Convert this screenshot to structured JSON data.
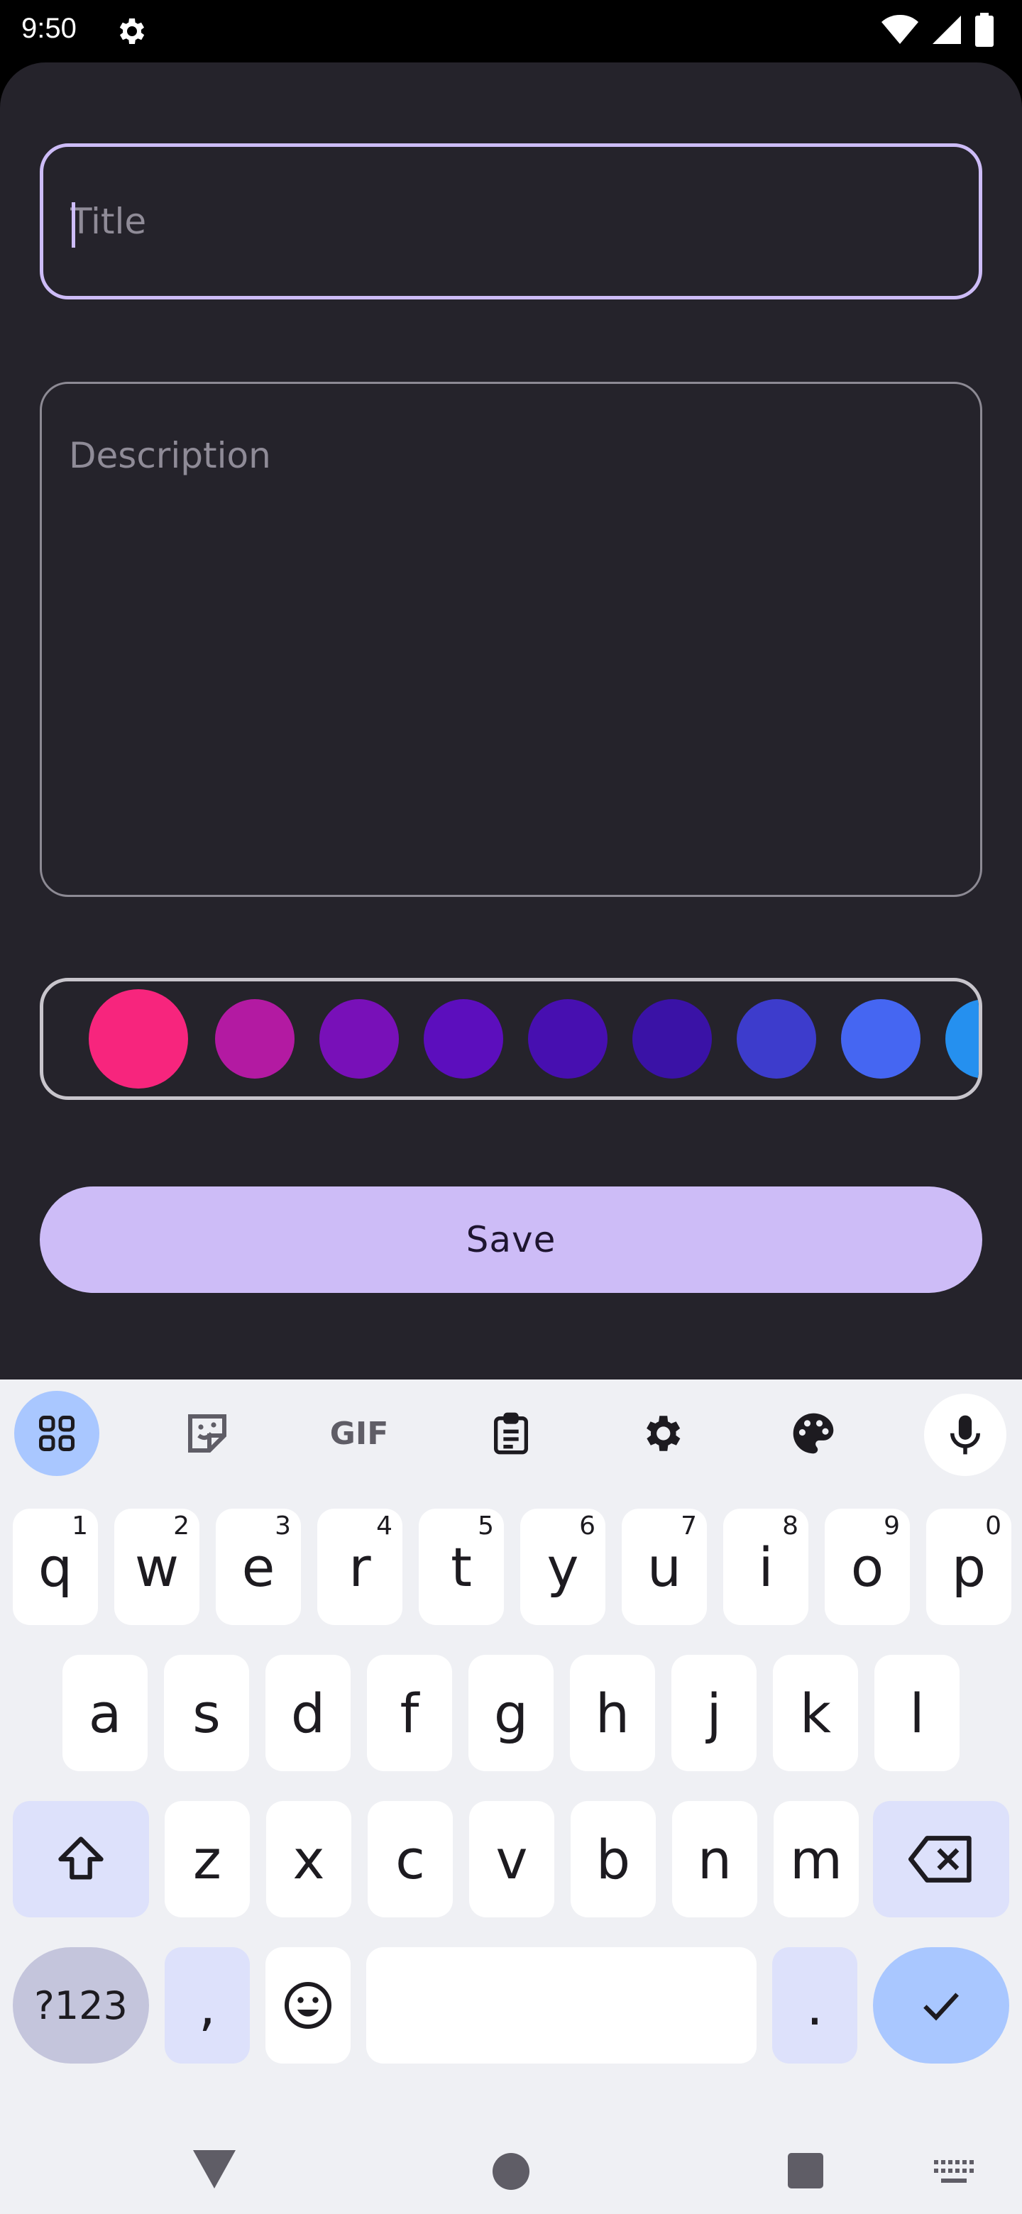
{
  "status_bar": {
    "time": "9:50",
    "settings_icon": "gear-icon",
    "wifi_icon": "wifi-icon",
    "signal_icon": "signal-icon",
    "battery_icon": "battery-icon"
  },
  "form": {
    "title_placeholder": "Title",
    "title_value": "",
    "description_placeholder": "Description",
    "description_value": "",
    "save_label": "Save"
  },
  "color_picker": {
    "selected_index": 0,
    "colors": [
      "#f7257d",
      "#b31aa2",
      "#7810b8",
      "#5c0ebd",
      "#470fb0",
      "#3a12a6",
      "#3d3ccc",
      "#4566f2",
      "#2590ef"
    ]
  },
  "keyboard": {
    "toolbar": [
      "apps-grid-icon",
      "sticker-icon",
      "gif-icon",
      "clipboard-icon",
      "settings-icon",
      "palette-icon",
      "mic-icon"
    ],
    "gif_label": "GIF",
    "row1": [
      {
        "key": "q",
        "hint": "1"
      },
      {
        "key": "w",
        "hint": "2"
      },
      {
        "key": "e",
        "hint": "3"
      },
      {
        "key": "r",
        "hint": "4"
      },
      {
        "key": "t",
        "hint": "5"
      },
      {
        "key": "y",
        "hint": "6"
      },
      {
        "key": "u",
        "hint": "7"
      },
      {
        "key": "i",
        "hint": "8"
      },
      {
        "key": "o",
        "hint": "9"
      },
      {
        "key": "p",
        "hint": "0"
      }
    ],
    "row2": [
      "a",
      "s",
      "d",
      "f",
      "g",
      "h",
      "j",
      "k",
      "l"
    ],
    "row3": [
      "z",
      "x",
      "c",
      "v",
      "b",
      "n",
      "m"
    ],
    "symbols_label": "?123",
    "comma": ",",
    "period": "."
  },
  "colors": {
    "sheet_bg": "#25232b",
    "accent": "#cdbcf7",
    "keyboard_bg": "#eff0f4",
    "enter": "#a9c7ff"
  }
}
